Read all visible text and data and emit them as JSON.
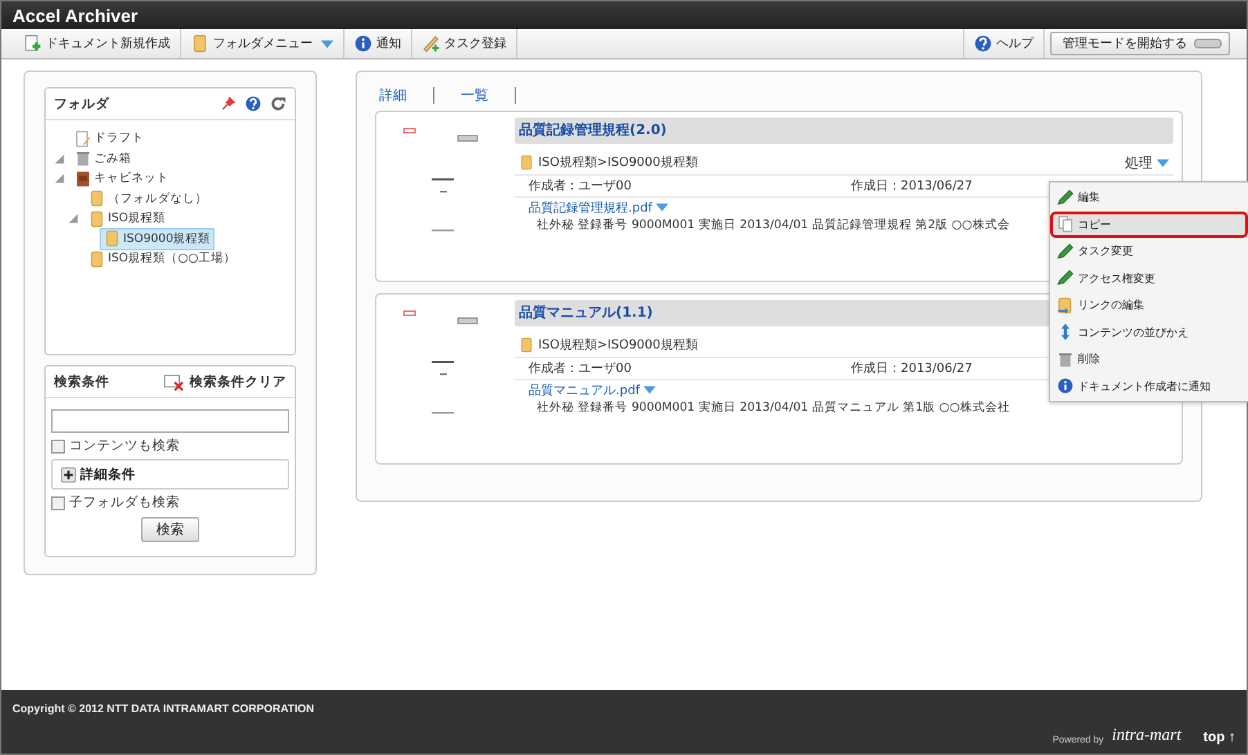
{
  "window": {
    "title": "Accel Archiver"
  },
  "toolbar": {
    "items": [
      {
        "label": "ドキュメント新規作成",
        "kind": "new-document"
      },
      {
        "label": "フォルダメニュー",
        "kind": "folder-menu"
      },
      {
        "label": "通知",
        "kind": "notify"
      },
      {
        "label": "タスク登録",
        "kind": "task"
      }
    ],
    "help": "ヘルプ",
    "admin_mode": {
      "label": "管理モードを開始する",
      "on": false
    }
  },
  "folder_panel": {
    "title": "フォルダ",
    "tree": [
      {
        "label": "ドラフト",
        "kind": "draft",
        "selected": false
      },
      {
        "label": "ごみ箱",
        "kind": "trash",
        "expanded": true,
        "selected": false
      },
      {
        "label": "キャビネット",
        "kind": "cabinet",
        "expanded": true,
        "selected": false,
        "children": [
          {
            "label": "（フォルダなし）",
            "kind": "folder",
            "selected": false
          },
          {
            "label": "ISO規程類",
            "kind": "folder",
            "expanded": true,
            "selected": false,
            "children": [
              {
                "label": "ISO9000規程類",
                "kind": "folder",
                "selected": true
              }
            ]
          },
          {
            "label": "ISO規程類（○○工場）",
            "kind": "folder",
            "selected": false
          }
        ]
      }
    ]
  },
  "search_panel": {
    "title": "検索条件",
    "clear": "検索条件クリア",
    "content_search": {
      "label": "コンテンツも検索",
      "checked": false
    },
    "details": {
      "label": "詳細条件",
      "expanded": false
    },
    "subfolder_search": {
      "label": "子フォルダも検索",
      "checked": false
    },
    "button": "検索"
  },
  "view_links": [
    "詳細",
    "一覧"
  ],
  "documents": [
    {
      "title": "品質記録管理規程(2.0)",
      "path": "ISO規程類>ISO9000規程類",
      "actions": "処理",
      "author": "作成者：ユーザ00",
      "date": "作成日：2013/06/27",
      "file": "品質記録管理規程.pdf",
      "description": "社外秘  登録番号  9000M001  実施日 2013/04/01 品質記録管理規程 第2版 ○○株式会"
    },
    {
      "title": "品質マニュアル(1.1)",
      "path": "ISO規程類>ISO9000規程類",
      "author": "作成者：ユーザ00",
      "date": "作成日：2013/06/27",
      "file": "品質マニュアル.pdf",
      "description": "社外秘  登録番号  9000M001  実施日 2013/04/01 品質マニュアル 第1版 ○○株式会社"
    }
  ],
  "action_menu": [
    {
      "label": "編集",
      "kind": "edit",
      "selected": false
    },
    {
      "label": "コピー",
      "kind": "copy",
      "selected": true
    },
    {
      "label": "タスク変更",
      "kind": "edit",
      "selected": false
    },
    {
      "label": "アクセス権変更",
      "kind": "edit",
      "selected": false
    },
    {
      "label": "リンクの編集",
      "kind": "link",
      "selected": false
    },
    {
      "label": "コンテンツの並びかえ",
      "kind": "sort",
      "selected": false
    },
    {
      "label": "削除",
      "kind": "delete",
      "selected": false
    },
    {
      "label": "ドキュメント作成者に通知",
      "kind": "notify",
      "selected": false
    }
  ],
  "footer": {
    "copyright": "Copyright © 2012 NTT DATA INTRAMART CORPORATION",
    "powered_by": "Powered by",
    "logo": "intra-mart",
    "top_link": "top ↑"
  }
}
